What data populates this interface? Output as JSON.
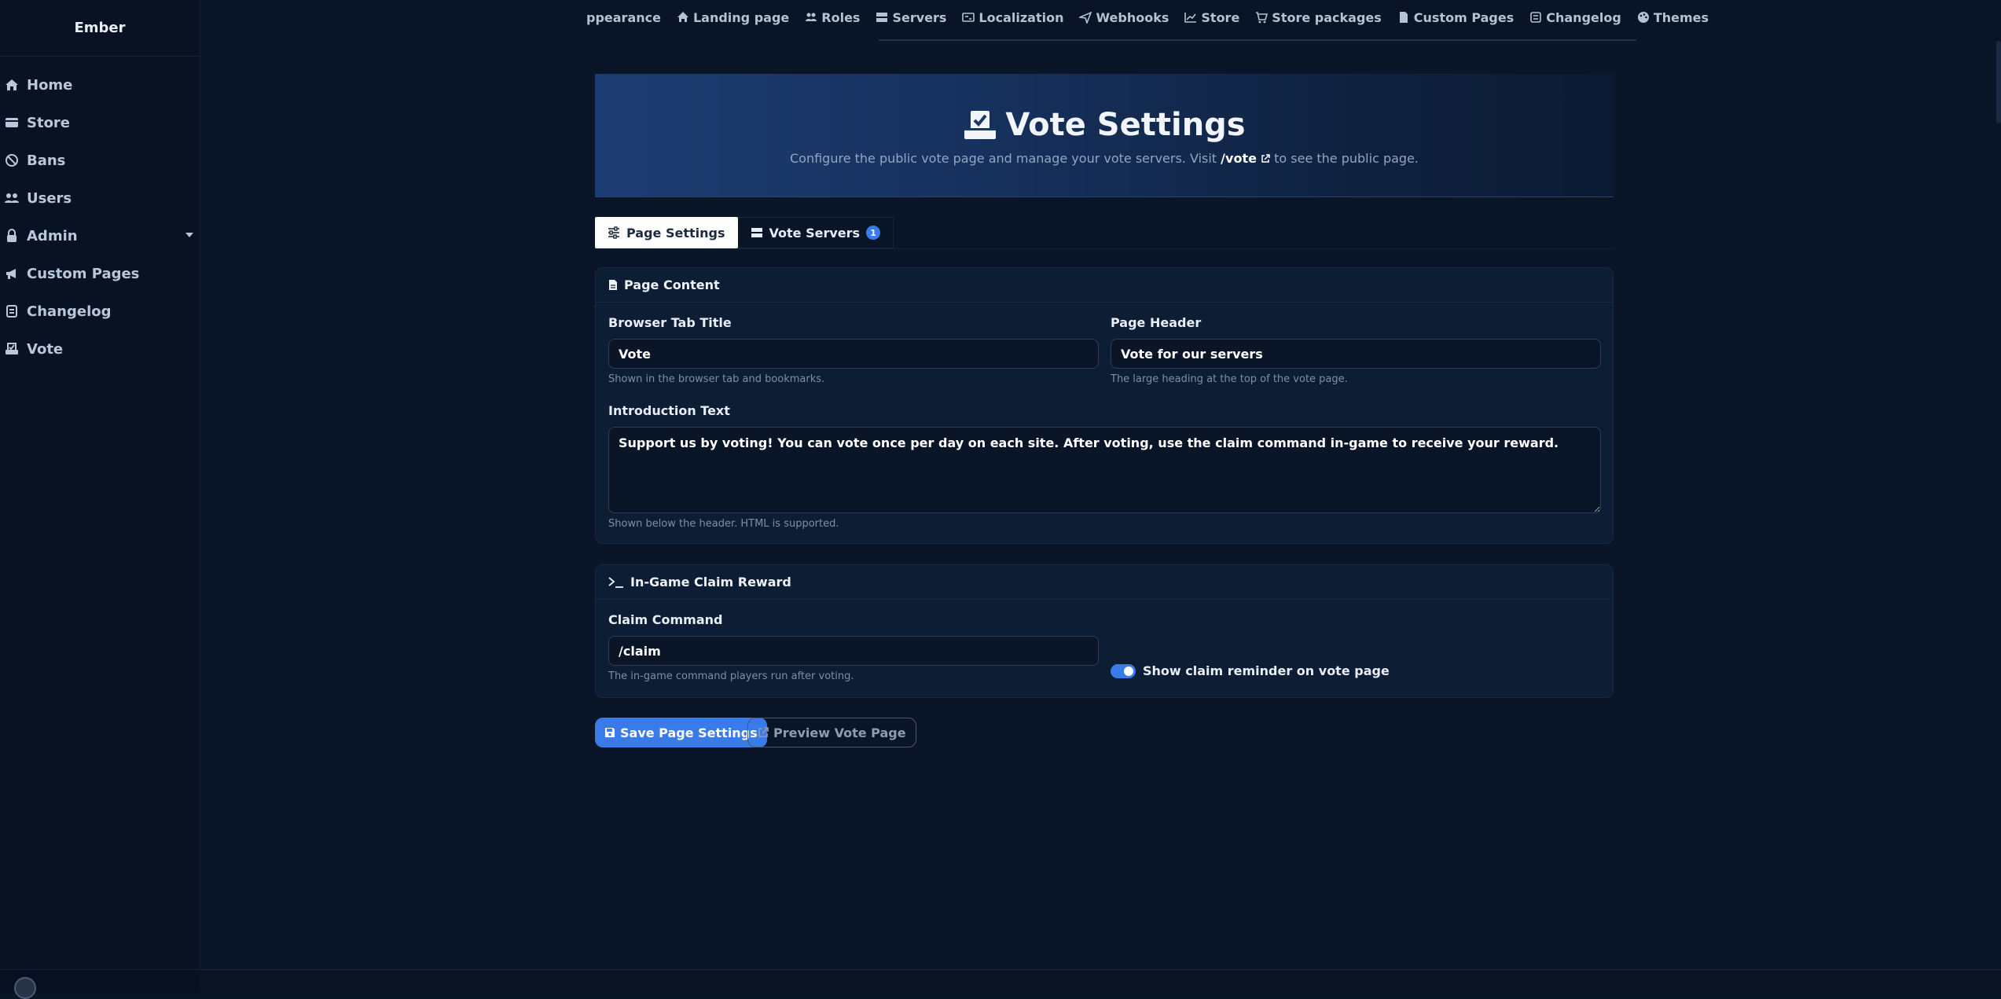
{
  "brand": "Ember",
  "sidebar": {
    "items": [
      {
        "label": "Home",
        "icon": "home-icon"
      },
      {
        "label": "Store",
        "icon": "store-icon"
      },
      {
        "label": "Bans",
        "icon": "ban-icon"
      },
      {
        "label": "Users",
        "icon": "users-icon"
      },
      {
        "label": "Admin",
        "icon": "lock-icon"
      },
      {
        "label": "Custom Pages",
        "icon": "megaphone-icon"
      },
      {
        "label": "Changelog",
        "icon": "scroll-icon"
      },
      {
        "label": "Vote",
        "icon": "vote-icon"
      }
    ]
  },
  "topnav": {
    "items": [
      {
        "label": "ppearance"
      },
      {
        "label": "Landing page"
      },
      {
        "label": "Roles"
      },
      {
        "label": "Servers"
      },
      {
        "label": "Localization"
      },
      {
        "label": "Webhooks"
      },
      {
        "label": "Store"
      },
      {
        "label": "Store packages"
      },
      {
        "label": "Custom Pages"
      },
      {
        "label": "Changelog"
      },
      {
        "label": "Themes"
      }
    ]
  },
  "hero": {
    "title": "Vote Settings",
    "sub_before": "Configure the public vote page and manage your vote servers. Visit",
    "sub_path": "/vote",
    "sub_after": "to see the public page."
  },
  "tabs": {
    "page_settings": "Page Settings",
    "vote_servers": "Vote Servers",
    "vote_servers_count": "1"
  },
  "page_content": {
    "header": "Page Content",
    "browser_tab_title_label": "Browser Tab Title",
    "browser_tab_title_value": "Vote",
    "browser_tab_title_help": "Shown in the browser tab and bookmarks.",
    "page_header_label": "Page Header",
    "page_header_value": "Vote for our servers",
    "page_header_help": "The large heading at the top of the vote page.",
    "intro_label": "Introduction Text",
    "intro_value": "Support us by voting! You can vote once per day on each site. After voting, use the claim command in-game to receive your reward.",
    "intro_help": "Shown below the header. HTML is supported."
  },
  "claim_reward": {
    "header": "In-Game Claim Reward",
    "command_label": "Claim Command",
    "command_value": "/claim",
    "command_help": "The in-game command players run after voting.",
    "toggle_label": "Show claim reminder on vote page",
    "toggle_on": true
  },
  "actions": {
    "save": "Save Page Settings",
    "preview": "Preview Vote Page"
  },
  "colors": {
    "accent": "#3a7bea",
    "background": "#0a1628"
  }
}
